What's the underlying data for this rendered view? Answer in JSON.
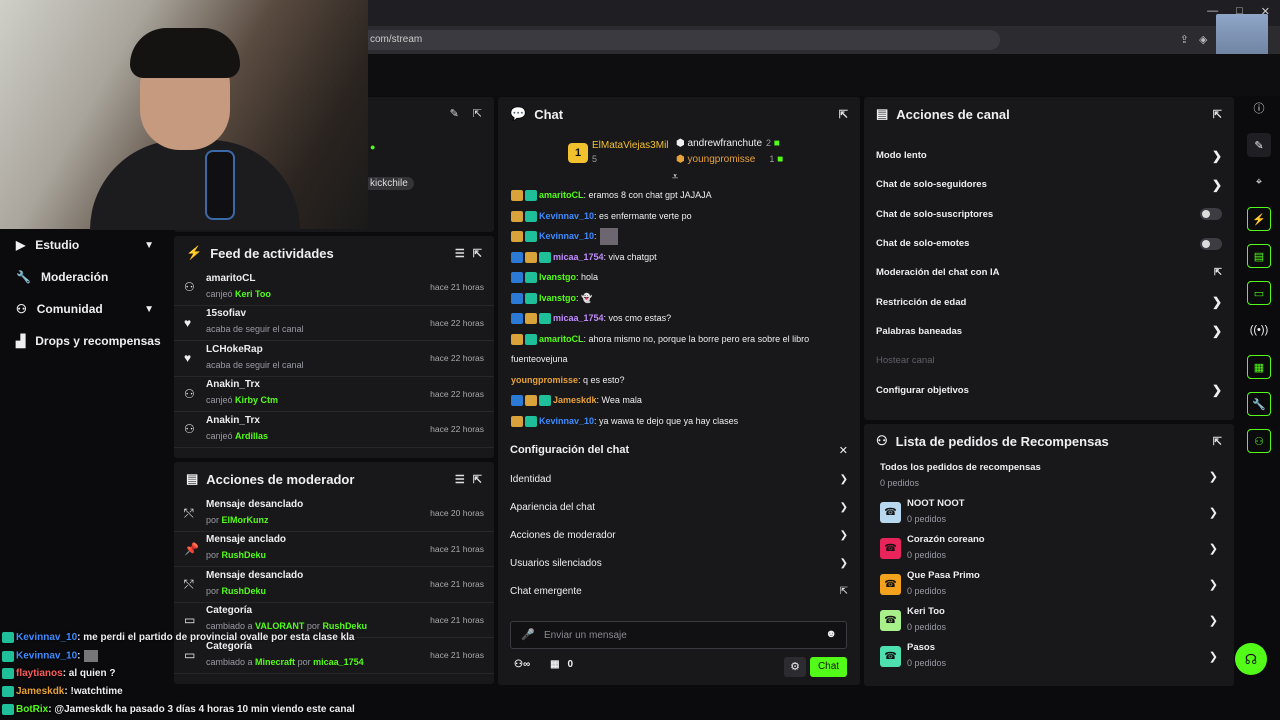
{
  "browser": {
    "url": "com/stream",
    "window_controls": [
      "—",
      "□",
      "✕"
    ]
  },
  "stream_badge": "x2",
  "header_panel": {
    "username_pill": "kickchile"
  },
  "sidebar": {
    "items": [
      {
        "label": "Estudio",
        "icon": "video-icon",
        "chevron": true
      },
      {
        "label": "Moderación",
        "icon": "wrench-icon",
        "chevron": false
      },
      {
        "label": "Comunidad",
        "icon": "community-icon",
        "chevron": true
      },
      {
        "label": "Drops y recompensas",
        "icon": "gift-icon",
        "chevron": false
      }
    ]
  },
  "feed": {
    "title": "Feed de actividades",
    "items": [
      {
        "user": "amaritoCL",
        "action": "canjeó",
        "extra": "Keri Too",
        "time": "hace 21 horas",
        "icon": "reward-icon"
      },
      {
        "user": "15sofiav",
        "action": "acaba de seguir el canal",
        "extra": "",
        "time": "hace 22 horas",
        "icon": "heart-icon"
      },
      {
        "user": "LCHokeRap",
        "action": "acaba de seguir el canal",
        "extra": "",
        "time": "hace 22 horas",
        "icon": "heart-icon"
      },
      {
        "user": "Anakin_Trx",
        "action": "canjeó",
        "extra": "Kirby Ctm",
        "time": "hace 22 horas",
        "icon": "reward-icon"
      },
      {
        "user": "Anakin_Trx",
        "action": "canjeó",
        "extra": "Ardillas",
        "time": "hace 22 horas",
        "icon": "reward-icon"
      }
    ]
  },
  "mod_actions": {
    "title": "Acciones de moderador",
    "items": [
      {
        "title": "Mensaje desanclado",
        "by": "por",
        "user": "ElMorKunz",
        "time": "hace 20 horas",
        "icon": "unpin-icon"
      },
      {
        "title": "Mensaje anclado",
        "by": "por",
        "user": "RushDeku",
        "time": "hace 21 horas",
        "icon": "pin-icon"
      },
      {
        "title": "Mensaje desanclado",
        "by": "por",
        "user": "RushDeku",
        "time": "hace 21 horas",
        "icon": "unpin-icon"
      },
      {
        "title": "Categoría",
        "by": "cambiado a",
        "user": "VALORANT",
        "by2": "por",
        "user2": "RushDeku",
        "time": "hace 21 horas",
        "icon": "category-icon"
      },
      {
        "title": "Categoría",
        "by": "cambiado a",
        "user": "Minecraft",
        "by2": "por",
        "user2": "micaa_1754",
        "time": "hace 21 horas",
        "icon": "category-icon"
      }
    ]
  },
  "chat": {
    "title": "Chat",
    "leaders": [
      {
        "name": "ElMataViejas3Mil",
        "count": "5",
        "rank": "1"
      },
      {
        "name": "andrewfranchute",
        "count": "2"
      },
      {
        "name": "youngpromisse",
        "count": "1"
      }
    ],
    "messages": [
      {
        "user": "amaritoCL",
        "color": "#53fc18",
        "text": ": eramos 8 con chat gpt JAJAJA",
        "badges": [
          "b2",
          "b3"
        ]
      },
      {
        "user": "Kevinnav_10",
        "color": "#3d8bff",
        "text": ": es enfermante verte po",
        "badges": [
          "b2",
          "b3"
        ]
      },
      {
        "user": "Kevinnav_10",
        "color": "#3d8bff",
        "text": ":",
        "badges": [
          "b2",
          "b3"
        ]
      },
      {
        "user": "micaa_1754",
        "color": "#c08cff",
        "text": ": viva chatgpt",
        "badges": [
          "b1",
          "b2",
          "b3"
        ]
      },
      {
        "user": "Ivanstgo",
        "color": "#53fc18",
        "text": ": hola",
        "badges": [
          "b1",
          "b3"
        ]
      },
      {
        "user": "Ivanstgo",
        "color": "#53fc18",
        "text": ": 👻",
        "badges": [
          "b1",
          "b3"
        ]
      },
      {
        "user": "micaa_1754",
        "color": "#c08cff",
        "text": ": vos cmo estas?",
        "badges": [
          "b1",
          "b2",
          "b3"
        ]
      },
      {
        "user": "amaritoCL",
        "color": "#53fc18",
        "text": ": ahora mismo no, porque la borre pero era sobre el libro",
        "badges": [
          "b2",
          "b3"
        ]
      },
      {
        "user": "",
        "color": "#efeff1",
        "text": "fuenteovejuna",
        "badges": []
      },
      {
        "user": "youngpromisse",
        "color": "#e8a23a",
        "text": ": q es esto?",
        "badges": []
      },
      {
        "user": "Jameskdk",
        "color": "#e8a23a",
        "text": ": Wea mala",
        "badges": [
          "b1",
          "b2",
          "b3"
        ]
      },
      {
        "user": "Kevinnav_10",
        "color": "#3d8bff",
        "text": ": ya wawa te dejo que ya hay clases",
        "badges": [
          "b2",
          "b3"
        ]
      }
    ],
    "config": {
      "title": "Configuración del chat",
      "items": [
        "Identidad",
        "Apariencia del chat",
        "Acciones de moderador",
        "Usuarios silenciados",
        "Chat emergente"
      ]
    },
    "input_placeholder": "Enviar un mensaje",
    "points": "0",
    "send_label": "Chat"
  },
  "channel_actions": {
    "title": "Acciones de canal",
    "items": [
      {
        "label": "Modo lento",
        "end": "chevron"
      },
      {
        "label": "Chat de solo-seguidores",
        "end": "chevron"
      },
      {
        "label": "Chat de solo-suscriptores",
        "end": "toggle"
      },
      {
        "label": "Chat de solo-emotes",
        "end": "toggle"
      },
      {
        "label": "Moderación del chat con IA",
        "end": "external"
      },
      {
        "label": "Restricción de edad",
        "end": "chevron"
      },
      {
        "label": "Palabras baneadas",
        "end": "chevron"
      },
      {
        "label": "Hostear canal",
        "end": "none",
        "disabled": true
      },
      {
        "label": "Configurar objetivos",
        "end": "chevron"
      }
    ]
  },
  "rewards": {
    "title": "Lista de pedidos de Recompensas",
    "all_label": "Todos los pedidos de recompensas",
    "all_count": "0 pedidos",
    "items": [
      {
        "name": "NOOT NOOT",
        "count": "0 pedidos",
        "color": "#b8d8f0"
      },
      {
        "name": "Corazón coreano",
        "count": "0 pedidos",
        "color": "#e8245a"
      },
      {
        "name": "Que Pasa Primo",
        "count": "0 pedidos",
        "color": "#f2a21c"
      },
      {
        "name": "Keri Too",
        "count": "0 pedidos",
        "color": "#a8f08a"
      },
      {
        "name": "Pasos",
        "count": "0 pedidos",
        "color": "#4fe0b0"
      }
    ]
  },
  "overlay_chat": [
    {
      "user": "Kevinnav_10",
      "color": "#3d8bff",
      "text": ": me perdi el partido de provincial ovalle por esta clase kla"
    },
    {
      "user": "Kevinnav_10",
      "color": "#3d8bff",
      "text": ":"
    },
    {
      "user": "flaytianos",
      "color": "#ff5a5a",
      "text": ": al quien ?"
    },
    {
      "user": "Jameskdk",
      "color": "#e8a23a",
      "text": ": !watchtime"
    },
    {
      "user": "BotRix",
      "color": "#53fc18",
      "text": ": @Jameskdk ha pasado 3 días 4 horas 10 min viendo este canal"
    }
  ]
}
